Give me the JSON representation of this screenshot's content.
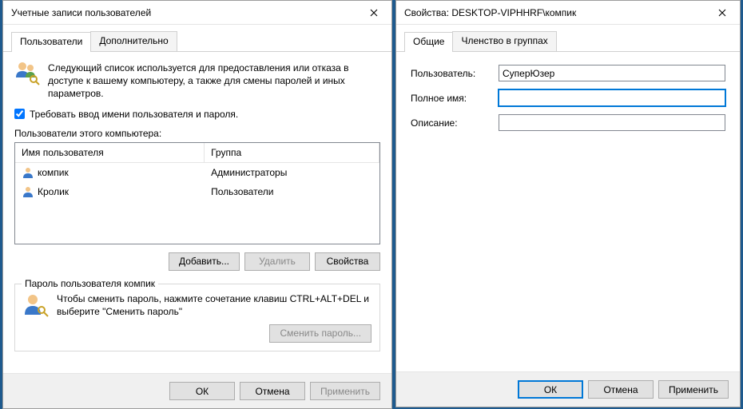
{
  "left": {
    "title": "Учетные записи пользователей",
    "tabs": {
      "users": "Пользователи",
      "advanced": "Дополнительно"
    },
    "intro": "Следующий список используется для предоставления или отказа в доступе к вашему компьютеру, а также для смены паролей и иных параметров.",
    "require_login": "Требовать ввод имени пользователя и пароля.",
    "users_label": "Пользователи этого компьютера:",
    "columns": {
      "name": "Имя пользователя",
      "group": "Группа"
    },
    "rows": [
      {
        "name": "компик",
        "group": "Администраторы"
      },
      {
        "name": "Кролик",
        "group": "Пользователи"
      }
    ],
    "buttons": {
      "add": "Добавить...",
      "remove": "Удалить",
      "props": "Свойства"
    },
    "password_group_title": "Пароль пользователя компик",
    "password_text": "Чтобы сменить пароль, нажмите сочетание клавиш CTRL+ALT+DEL и выберите \"Сменить пароль\"",
    "change_password": "Сменить пароль...",
    "footer": {
      "ok": "ОК",
      "cancel": "Отмена",
      "apply": "Применить"
    }
  },
  "right": {
    "title": "Свойства: DESKTOP-VIPHHRF\\компик",
    "tabs": {
      "general": "Общие",
      "membership": "Членство в группах"
    },
    "labels": {
      "user": "Пользователь:",
      "fullname": "Полное имя:",
      "description": "Описание:"
    },
    "values": {
      "user": "СуперЮзер",
      "fullname": "",
      "description": ""
    },
    "footer": {
      "ok": "ОК",
      "cancel": "Отмена",
      "apply": "Применить"
    }
  }
}
